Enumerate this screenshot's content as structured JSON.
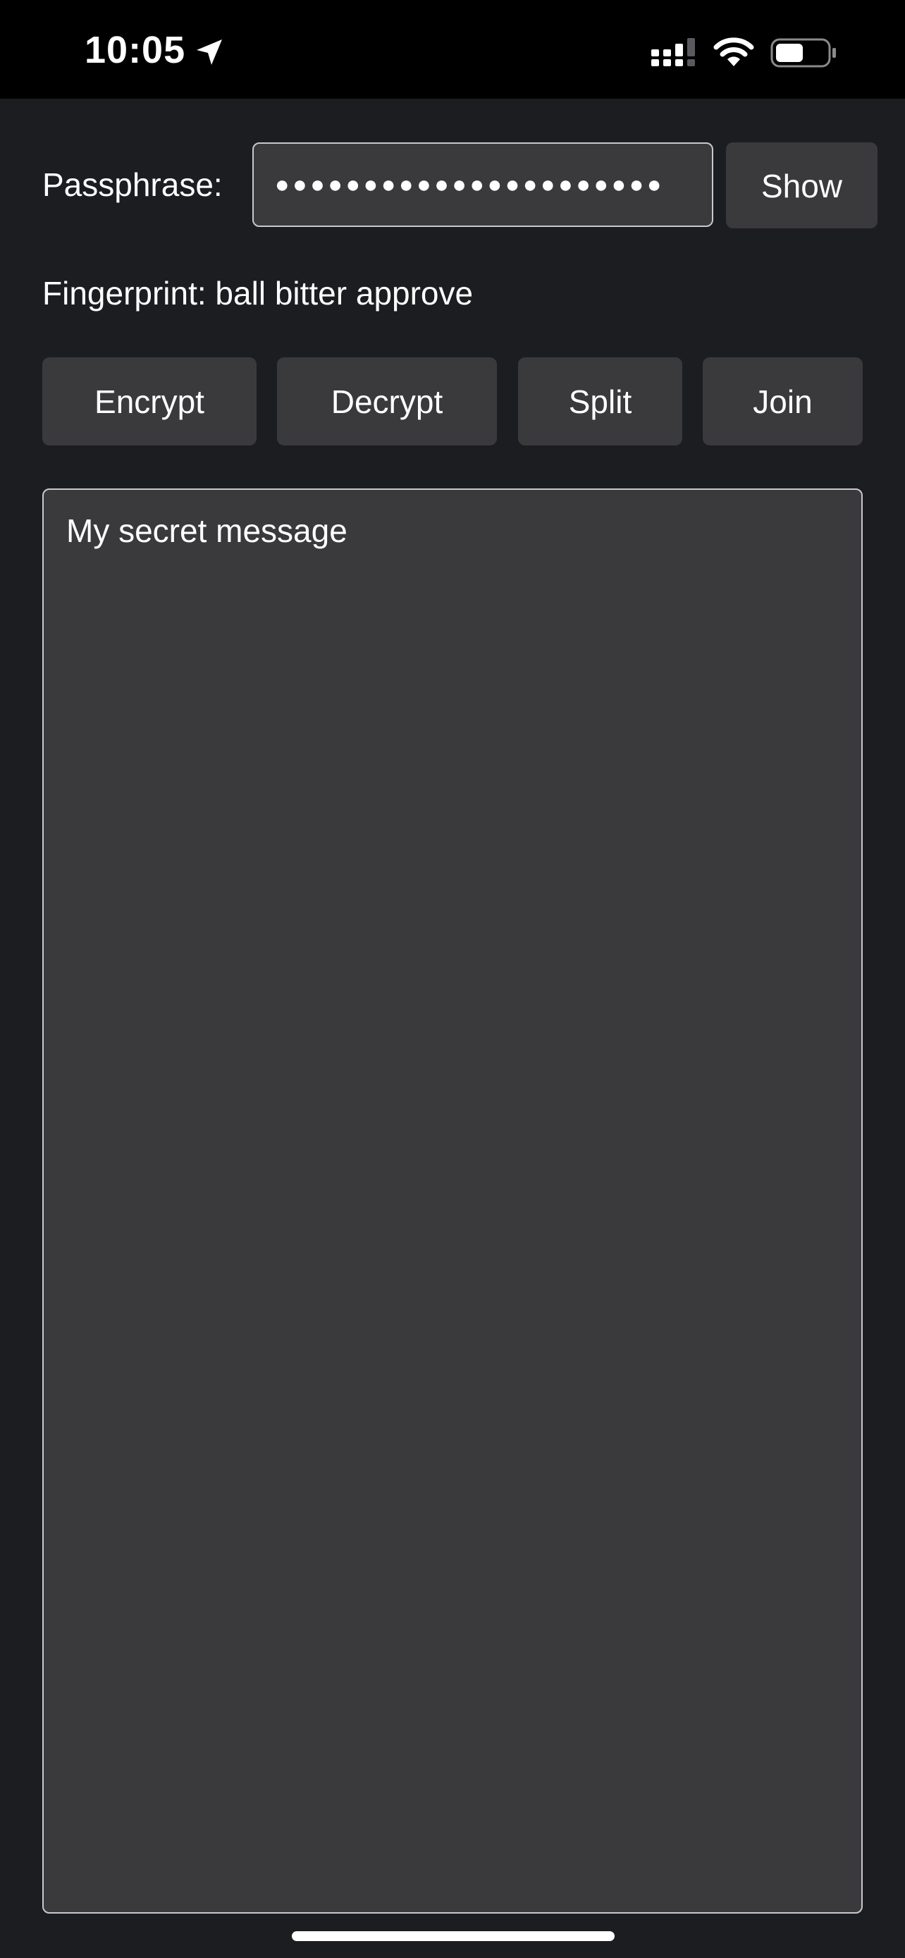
{
  "status_bar": {
    "time": "10:05",
    "icons": [
      "location-arrow-icon",
      "cellular-signal-icon",
      "wifi-icon",
      "battery-icon"
    ]
  },
  "passphrase": {
    "label": "Passphrase:",
    "masked_value": "●●●●●●●●●●●●●●●●●●●●●●"
  },
  "show_button": {
    "label": "Show"
  },
  "fingerprint": {
    "text": "Fingerprint: ball bitter approve"
  },
  "actions": {
    "encrypt": "Encrypt",
    "decrypt": "Decrypt",
    "split": "Split",
    "join": "Join"
  },
  "message": {
    "text": "My secret message"
  },
  "colors": {
    "background": "#1c1d21",
    "status_bar": "#000000",
    "control": "#3a3a3d",
    "border": "#c9c9cc",
    "text": "#ffffff"
  }
}
